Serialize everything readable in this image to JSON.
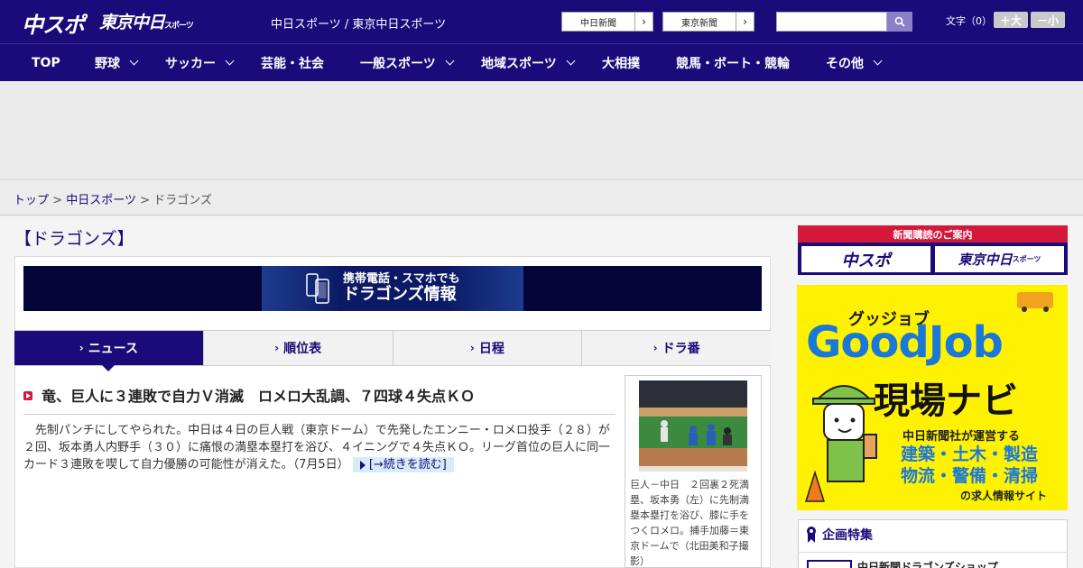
{
  "header": {
    "logo_chuspo": "中スポ",
    "logo_tokyo": "東京中日",
    "logo_tokyo_small": "スポーツ",
    "site_title": "中日スポーツ / 東京中日スポーツ",
    "paper_links": [
      {
        "label": "中日新聞",
        "arrow": "›"
      },
      {
        "label": "東京新聞",
        "arrow": "›"
      }
    ],
    "search": {
      "value": "",
      "placeholder": ""
    },
    "font_size_label": "文字（0）",
    "font_bigger": "＋大",
    "font_smaller": "－小"
  },
  "nav": {
    "items": [
      {
        "label": "TOP",
        "has_menu": false
      },
      {
        "label": "野球",
        "has_menu": true
      },
      {
        "label": "サッカー",
        "has_menu": true
      },
      {
        "label": "芸能・社会",
        "has_menu": false
      },
      {
        "label": "一般スポーツ",
        "has_menu": true
      },
      {
        "label": "地域スポーツ",
        "has_menu": true
      },
      {
        "label": "大相撲",
        "has_menu": false
      },
      {
        "label": "競馬・ボート・競輪",
        "has_menu": false
      },
      {
        "label": "その他",
        "has_menu": true
      }
    ]
  },
  "breadcrumb": {
    "items": [
      "トップ",
      "中日スポーツ",
      "ドラゴンズ"
    ],
    "separator": ">"
  },
  "section_title": "【ドラゴンズ】",
  "banner": {
    "line1": "携帯電話・スマホでも",
    "line2": "ドラゴンズ情報"
  },
  "tabs": [
    {
      "label": "ニュース",
      "active": true
    },
    {
      "label": "順位表",
      "active": false
    },
    {
      "label": "日程",
      "active": false
    },
    {
      "label": "ドラ番",
      "active": false
    }
  ],
  "article": {
    "headline": "竜、巨人に３連敗で自力Ｖ消滅　ロメロ大乱調、７四球４失点ＫＯ",
    "body": "先制パンチにしてやられた。中日は４日の巨人戦（東京ドーム）で先発したエンニー・ロメロ投手（２８）が２回、坂本勇人内野手（３０）に痛恨の満塁本塁打を浴び、４イニングで４失点ＫＯ。リーグ首位の巨人に同一カード３連敗を喫して自力優勝の可能性が消えた。",
    "date": "（7月5日）",
    "more_label": "[→続きを読む]",
    "photo_caption": "巨人－中日　２回裏２死満塁、坂本勇（左）に先制満塁本塁打を浴び、膝に手をつくロメロ。捕手加藤＝東京ドームで（北田美和子撮影）"
  },
  "sidebar": {
    "subscription_header": "新聞購読のご案内",
    "subscription_buttons": [
      "中スポ",
      "東京中日"
    ],
    "subscription_small": "スポーツ",
    "ad": {
      "ruby": "グッジョブ",
      "title": "GoodJob",
      "subtitle": "現場ナビ",
      "operator": "中日新聞社が運営する",
      "jobs_line1": "建築・土木・製造",
      "jobs_line2": "物流・警備・清掃",
      "site_label": "の求人情報サイト"
    },
    "features_title": "企画特集",
    "features_first_item": "中日新聞ドラゴンズショップ"
  },
  "colors": {
    "brand_navy": "#1a0a7a",
    "accent_red": "#d4183a",
    "ad_yellow": "#fff200",
    "ad_blue": "#1a78d8"
  }
}
